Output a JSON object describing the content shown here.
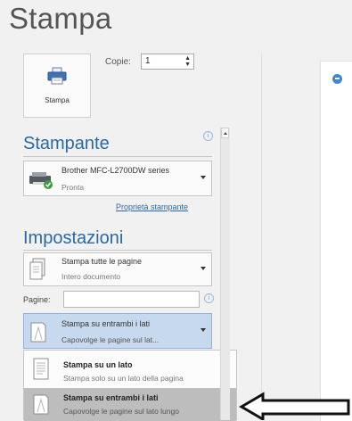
{
  "title": "Stampa",
  "print_button": {
    "label": "Stampa",
    "icon": "printer-icon"
  },
  "copies": {
    "label": "Copie:",
    "value": "1"
  },
  "printer": {
    "section_title": "Stampante",
    "name": "Brother MFC-L2700DW series",
    "status": "Pronta",
    "properties_link": "Proprietà stampante"
  },
  "settings": {
    "section_title": "Impostazioni",
    "range": {
      "title": "Stampa tutte le pagine",
      "subtitle": "Intero documento"
    },
    "pages": {
      "label": "Pagine:",
      "value": ""
    },
    "duplex": {
      "title": "Stampa su entrambi i lati",
      "subtitle": "Capovolge le pagine sul lat..."
    }
  },
  "duplex_menu": {
    "items": [
      {
        "title": "Stampa su un lato",
        "subtitle": "Stampa solo su un lato della pagina"
      },
      {
        "title": "Stampa su entrambi i lati",
        "subtitle": "Capovolge le pagine sul lato lungo"
      }
    ]
  },
  "colors": {
    "accent": "#2b68a8",
    "selection": "#c7d9ee",
    "hover": "#bdbdbd",
    "badge": "#3b86d6"
  }
}
